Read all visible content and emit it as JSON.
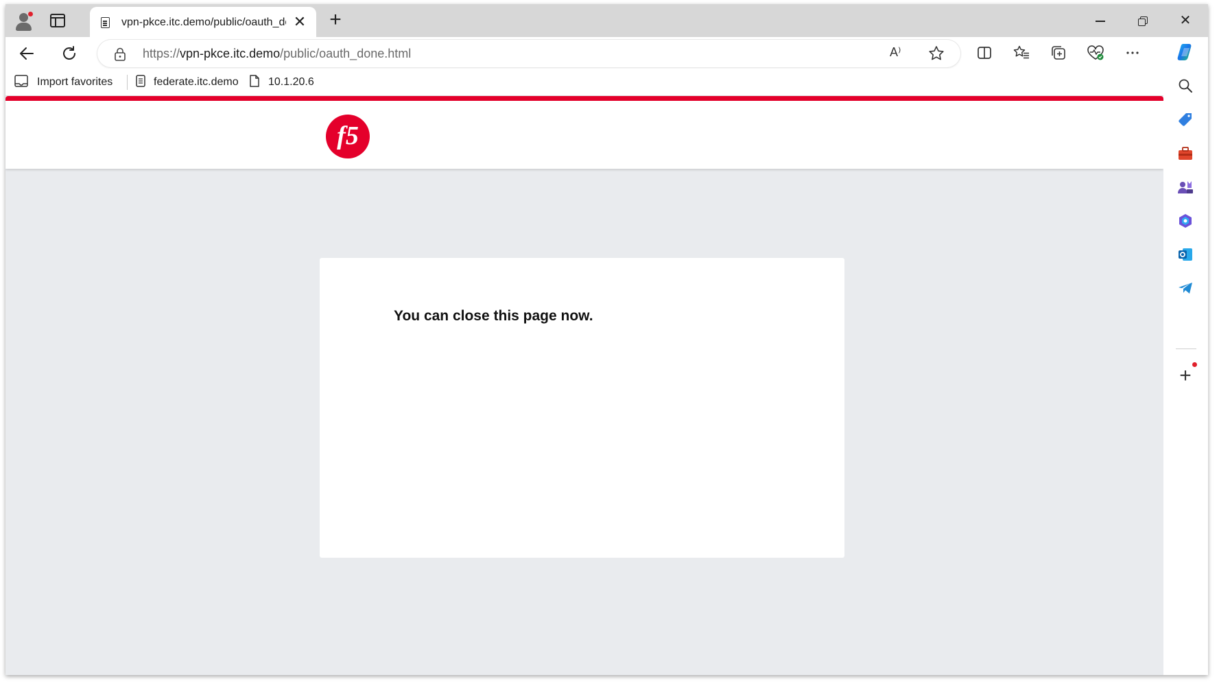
{
  "browser": {
    "tab": {
      "title": "vpn-pkce.itc.demo/public/oauth_done.html",
      "close_glyph": "✕"
    },
    "newtab_glyph": "+",
    "window_controls": {
      "close_glyph": "✕"
    },
    "address_bar": {
      "scheme": "https://",
      "host": "vpn-pkce.itc.demo",
      "path": "/public/oauth_done.html",
      "read_aloud_glyph": "A⁾"
    },
    "toolbar_icons": [
      "split-screen-icon",
      "favorites-icon",
      "collections-icon",
      "browser-essentials-icon",
      "more-icon",
      "copilot-icon"
    ],
    "bookmarks": [
      {
        "label": "Import favorites",
        "icon": "import-favorites-icon"
      },
      {
        "label": "federate.itc.demo",
        "icon": "page-icon"
      },
      {
        "label": "10.1.20.6",
        "icon": "document-icon"
      }
    ],
    "sidebar_icons": [
      "search-icon",
      "shopping-tag-icon",
      "tools-icon",
      "games-icon",
      "microsoft365-icon",
      "outlook-icon",
      "telegram-icon",
      "add-icon"
    ]
  },
  "page": {
    "brand": {
      "logo_text": "f5",
      "accent": "#e4002b"
    },
    "message": "You can close this page now."
  },
  "colors": {
    "page_bg": "#e9ebee",
    "card_bg": "#ffffff",
    "titlebar_bg": "#d7d7d7"
  }
}
